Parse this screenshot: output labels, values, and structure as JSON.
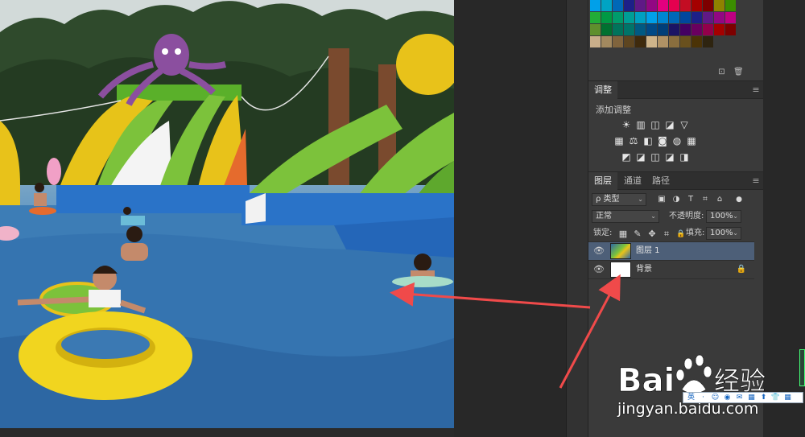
{
  "colors": {
    "panel_bg": "#3a3a3a",
    "selected_layer": "#4d5f78",
    "arrow": "#f04a4a"
  },
  "swatches": {
    "rows": [
      [
        "#00a0e9",
        "#00a3c4",
        "#0068b7",
        "#1d2088",
        "#601986",
        "#920783",
        "#e4007f",
        "#e5004f",
        "#c30d23",
        "#a40000",
        "#7d0000",
        "#8f8200",
        "#3b8d00"
      ],
      [
        "#22ac38",
        "#009944",
        "#009b6b",
        "#009e96",
        "#00a0c1",
        "#00a0e9",
        "#0086d1",
        "#0068b7",
        "#00479d",
        "#1d2088",
        "#601986",
        "#920783",
        "#be0081"
      ],
      [
        "#5f8f2d",
        "#007130",
        "#00735b",
        "#007469",
        "#005982",
        "#004986",
        "#003e78",
        "#1b1464",
        "#440062",
        "#6a005f",
        "#93004b",
        "#a40000",
        "#7d0000"
      ],
      [
        "#c9ae8a",
        "#a2895f",
        "#80643d",
        "#5d4520",
        "#3e2a0d",
        "#ceb48a",
        "#b09265",
        "#8a6e3e",
        "#69501d",
        "#4b3306",
        "#2e2410",
        "",
        ""
      ]
    ]
  },
  "swatch_footer": {
    "new_icon": "new-swatch-icon",
    "trash_icon": "trash-icon"
  },
  "adjustments": {
    "tab": "调整",
    "add_label": "添加调整",
    "row1": [
      "☀",
      "▥",
      "◫",
      "◪",
      "▽"
    ],
    "row2": [
      "▦",
      "⚖",
      "◧",
      "◙",
      "◍",
      "▦"
    ],
    "row3": [
      "◩",
      "◪",
      "◫",
      "◪",
      "◨"
    ]
  },
  "layers_panel": {
    "tabs": [
      "图层",
      "通道",
      "路径"
    ],
    "filter_kind": "ρ 类型",
    "filter_icons": [
      "▣",
      "◑",
      "T",
      "⌗",
      "⌂"
    ],
    "blend_mode": "正常",
    "opacity_label": "不透明度:",
    "opacity_value": "100%",
    "lock_label": "锁定:",
    "lock_icons": [
      "▦",
      "✎",
      "✥",
      "⌗",
      "🔒"
    ],
    "fill_label": "填充:",
    "fill_value": "100%",
    "layers": [
      {
        "name": "图层 1",
        "selected": true
      },
      {
        "name": "背景",
        "selected": false,
        "locked": true
      }
    ]
  },
  "watermark": {
    "brand_left": "Bai",
    "brand_right": "经验",
    "url": "jingyan.baidu.com",
    "bar_icons": [
      "英",
      "·",
      "☺",
      "◉",
      "✉",
      "▦",
      "⬆",
      "👕",
      "▦"
    ]
  }
}
